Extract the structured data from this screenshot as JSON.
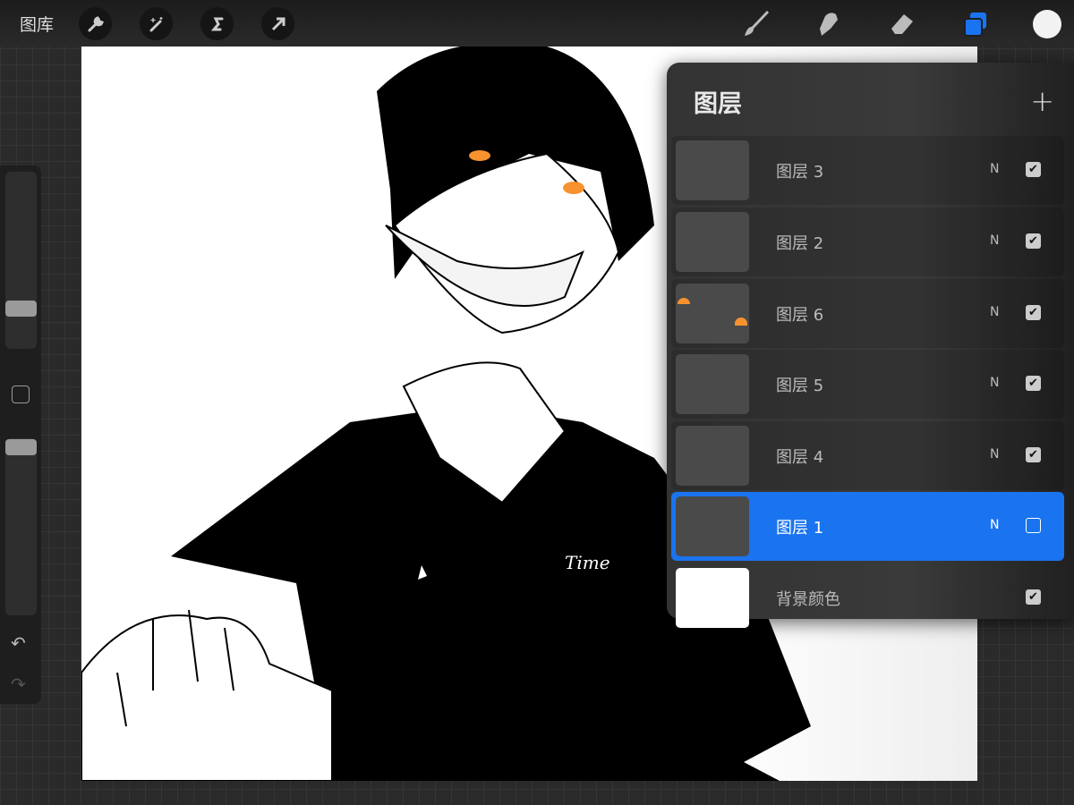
{
  "topbar": {
    "gallery_label": "图库",
    "tools": [
      "wrench-icon",
      "magic-wand-icon",
      "selection-icon",
      "transform-arrow-icon"
    ],
    "right_tools": [
      "brush-icon",
      "smudge-icon",
      "eraser-icon",
      "layers-icon",
      "color-icon"
    ],
    "accent": "#1a74f0",
    "current_color": "#f2f2f2"
  },
  "sidebar": {
    "brush_size_level": 0.77,
    "opacity_level": 0.95
  },
  "canvas": {
    "signature": "Time"
  },
  "layers": {
    "title": "图层",
    "add_label": "+",
    "items": [
      {
        "name": "图层 3",
        "mode": "N",
        "visible": true,
        "selected": false
      },
      {
        "name": "图层 2",
        "mode": "N",
        "visible": true,
        "selected": false
      },
      {
        "name": "图层 6",
        "mode": "N",
        "visible": true,
        "selected": false
      },
      {
        "name": "图层 5",
        "mode": "N",
        "visible": true,
        "selected": false
      },
      {
        "name": "图层 4",
        "mode": "N",
        "visible": true,
        "selected": false
      },
      {
        "name": "图层 1",
        "mode": "N",
        "visible": false,
        "selected": true
      },
      {
        "name": "背景颜色",
        "mode": "",
        "visible": true,
        "selected": false
      }
    ]
  }
}
